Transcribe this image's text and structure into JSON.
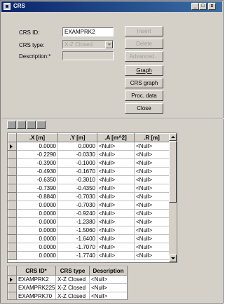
{
  "window": {
    "title": "CRS"
  },
  "titlebar_buttons": [
    "_",
    "□",
    "x"
  ],
  "form": {
    "crs_id_label": "CRS ID:",
    "crs_id_value": "EXAMPRK2",
    "crs_type_label": "CRS type:",
    "crs_type_value": "X-Z Closed",
    "description_label": "Description:*",
    "description_value": ""
  },
  "buttons": {
    "insert": "Insert",
    "delete": "Delete",
    "advanced": "Advanced...",
    "graph": "Graph",
    "crs_graph": "CRS graph",
    "proc_data": "Proc. data",
    "close": "Close"
  },
  "points_table": {
    "headers": [
      ".X [m]",
      ".Y [m]",
      ".A [m^2]",
      ".R [m]"
    ],
    "rows": [
      [
        "0.0000",
        "0.0000",
        "<Null>",
        "<Null>"
      ],
      [
        "-0.2290",
        "-0.0330",
        "<Null>",
        "<Null>"
      ],
      [
        "-0.3900",
        "-0.1000",
        "<Null>",
        "<Null>"
      ],
      [
        "-0.4930",
        "-0.1670",
        "<Null>",
        "<Null>"
      ],
      [
        "-0.6350",
        "-0.3010",
        "<Null>",
        "<Null>"
      ],
      [
        "-0.7390",
        "-0.4350",
        "<Null>",
        "<Null>"
      ],
      [
        "-0.8840",
        "-0.7030",
        "<Null>",
        "<Null>"
      ],
      [
        "0.0000",
        "-0.7030",
        "<Null>",
        "<Null>"
      ],
      [
        "0.0000",
        "-0.9240",
        "<Null>",
        "<Null>"
      ],
      [
        "0.0000",
        "-1.2380",
        "<Null>",
        "<Null>"
      ],
      [
        "0.0000",
        "-1.5060",
        "<Null>",
        "<Null>"
      ],
      [
        "0.0000",
        "-1.6400",
        "<Null>",
        "<Null>"
      ],
      [
        "0.0000",
        "-1.7070",
        "<Null>",
        "<Null>"
      ],
      [
        "0.0000",
        "-1.7740",
        "<Null>",
        "<Null>"
      ]
    ]
  },
  "crs_table": {
    "headers": [
      "CRS ID*",
      "CRS type",
      "Description"
    ],
    "rows": [
      [
        "EXAMPRK2",
        "X-Z Closed",
        "<Null>"
      ],
      [
        "EXAMPRK225",
        "X-Z Closed",
        "<Null>"
      ],
      [
        "EXAMPRK70",
        "X-Z Closed",
        "<Null>"
      ]
    ]
  },
  "toolbar_icons": [
    "grid-icon",
    "delete-row-icon",
    "move-up-icon",
    "move-down-icon"
  ]
}
